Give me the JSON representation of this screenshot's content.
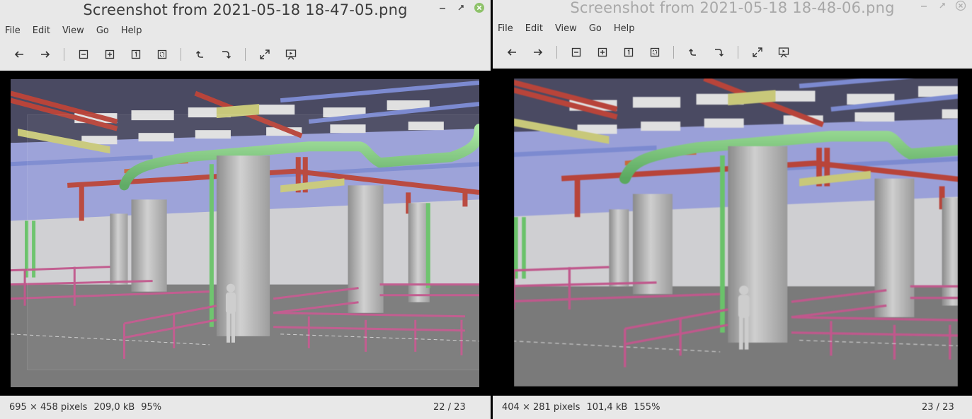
{
  "windows": [
    {
      "title": "Screenshot from 2021-05-18 18-47-05.png",
      "menus": [
        "File",
        "Edit",
        "View",
        "Go",
        "Help"
      ],
      "status": {
        "dimensions": "695 × 458 pixels",
        "filesize": "209,0 kB",
        "zoom": "95%",
        "pager": "22 / 23"
      }
    },
    {
      "title": "Screenshot from 2021-05-18 18-48-06.png",
      "menus": [
        "File",
        "Edit",
        "View",
        "Go",
        "Help"
      ],
      "status": {
        "dimensions": "404 × 281 pixels",
        "filesize": "101,4 kB",
        "zoom": "155%",
        "pager": "23 / 23"
      }
    }
  ],
  "toolbar_icons": [
    "back-arrow-icon",
    "forward-arrow-icon",
    "zoom-out-icon",
    "zoom-in-icon",
    "zoom-normal-icon",
    "zoom-fit-icon",
    "rotate-left-icon",
    "rotate-right-icon",
    "fullscreen-icon",
    "slideshow-icon"
  ],
  "colors": {
    "chrome": "#e8e8e8",
    "close_green": "#8ec26a",
    "pipe_green": "#78c878",
    "pipe_red": "#c0463c",
    "duct_blue": "#8c9cd8",
    "rail_pink": "#c05a8c"
  }
}
